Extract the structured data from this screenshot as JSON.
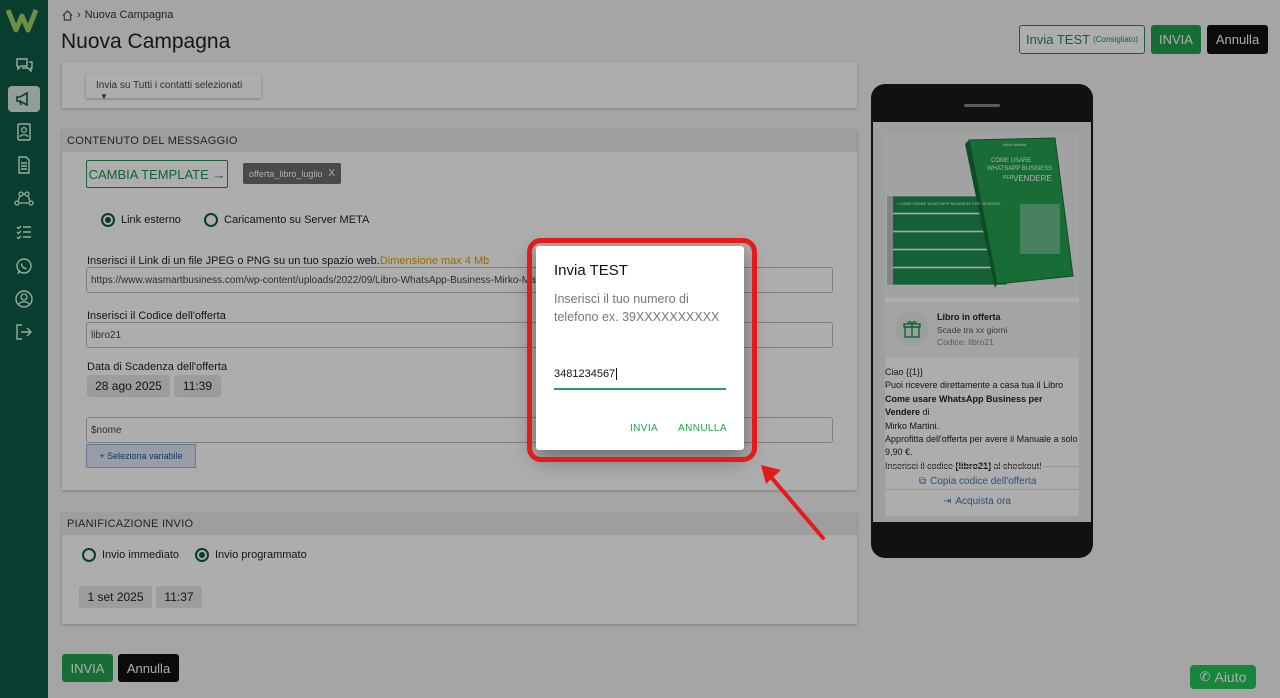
{
  "breadcrumb": {
    "current": "Nuova Campagna"
  },
  "header": {
    "title": "Nuova Campagna",
    "btn_test": "Invia TEST",
    "btn_test_note": "(Consigliato)",
    "btn_invia": "INVIA",
    "btn_annulla": "Annulla"
  },
  "sidebar": {
    "items": [
      {
        "icon": "chat-icon"
      },
      {
        "icon": "megaphone-icon",
        "active": true
      },
      {
        "icon": "contacts-icon"
      },
      {
        "icon": "document-icon"
      },
      {
        "icon": "flow-icon"
      },
      {
        "icon": "checklist-icon"
      },
      {
        "icon": "whatsapp-icon"
      },
      {
        "icon": "user-icon"
      },
      {
        "icon": "logout-icon"
      }
    ]
  },
  "recipients": {
    "select_value": "Invia su Tutti i contatti selezionati"
  },
  "content": {
    "section_title": "CONTENUTO DEL MESSAGGIO",
    "change_template": "CAMBIA TEMPLATE →",
    "template_chip": "offerta_libro_luglio",
    "chip_close": "X",
    "radio_external": "Link esterno",
    "radio_meta": "Caricamento su Server META",
    "link_label": "Inserisci il Link di un file JPEG o PNG su un tuo spazio web.",
    "link_warn": "Dimensione max 4 Mb",
    "link_value": "https://www.wasmartbusiness.com/wp-content/uploads/2022/09/Libro-WhatsApp-Business-Mirko-Martini",
    "code_label": "Inserisci il Codice dell'offerta",
    "code_value": "libro21",
    "expiry_label": "Data di Scadenza dell'offerta",
    "expiry_date": "28 ago 2025",
    "expiry_time": "11:39",
    "var_value": "$nome",
    "select_var": "+ Seleziona variabile"
  },
  "schedule": {
    "section_title": "PIANIFICAZIONE INVIO",
    "radio_now": "Invio immediato",
    "radio_scheduled": "Invio programmato",
    "date": "1 set 2025",
    "time": "11:37"
  },
  "footer": {
    "invia": "INVIA",
    "annulla": "Annulla"
  },
  "preview": {
    "offer_title": "Libro in offerta",
    "offer_expiry": "Scade tra xx giorni",
    "offer_code": "Codice: libro21",
    "line1": "Ciao {{1}}",
    "line2": "Puoi ricevere direttamente a casa tua il Libro",
    "line3_bold": "Come usare WhatsApp Business per Vendere",
    "line3_rest": " di",
    "line4": "Mirko Martini.",
    "line5": "Approfitta dell'offerta per avere il Manuale a solo 9,90 €.",
    "line6_pre": "Inserisci il codice ",
    "line6_bold": "[libro21]",
    "line6_post": " al checkout!",
    "copy_code": "Copia codice dell'offerta",
    "buy_now": "Acquista ora",
    "book_brand": "Mirko Martini",
    "book_title1": "COME USARE",
    "book_title2": "WHATSAPP BUSINESS",
    "book_title3": "PER",
    "book_title4": "VENDERE",
    "book_spine": "• COME USARE WHATSAPP BUSINESS PER VENDERE"
  },
  "dialog": {
    "title": "Invia TEST",
    "text": "Inserisci il tuo numero di telefono ex. 39XXXXXXXXXX",
    "input_value": "3481234567",
    "btn_invia": "INVIA",
    "btn_annulla": "ANNULLA"
  },
  "help": {
    "label": "Aiuto"
  },
  "colors": {
    "brand": "#0c5a46",
    "accent": "#24a150",
    "highlight": "#e41b1b"
  }
}
